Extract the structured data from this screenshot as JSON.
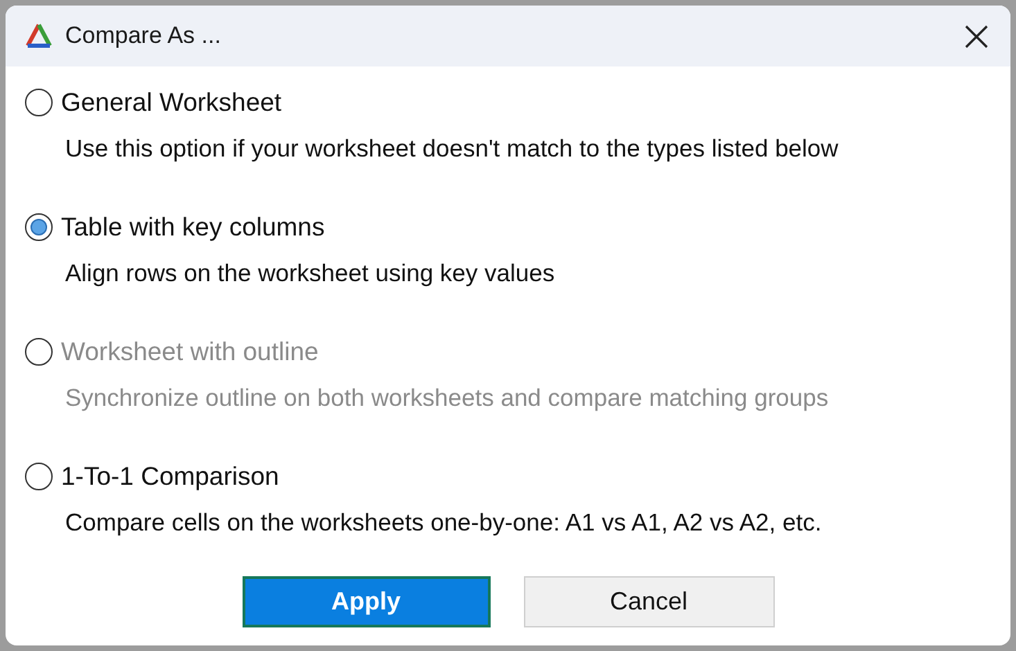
{
  "window": {
    "title": "Compare As ..."
  },
  "options": [
    {
      "label": "General Worksheet",
      "description": "Use this option if your worksheet doesn't match to the types listed below",
      "selected": false,
      "disabled": false
    },
    {
      "label": "Table with key columns",
      "description": "Align rows on the worksheet using key values",
      "selected": true,
      "disabled": false
    },
    {
      "label": "Worksheet with outline",
      "description": "Synchronize outline on both worksheets and compare matching groups",
      "selected": false,
      "disabled": true
    },
    {
      "label": "1-To-1 Comparison",
      "description": "Compare cells on the worksheets one-by-one: A1 vs A1, A2 vs A2, etc.",
      "selected": false,
      "disabled": false
    }
  ],
  "buttons": [
    {
      "label": "Apply",
      "kind": "primary"
    },
    {
      "label": "Cancel",
      "kind": "secondary"
    }
  ]
}
